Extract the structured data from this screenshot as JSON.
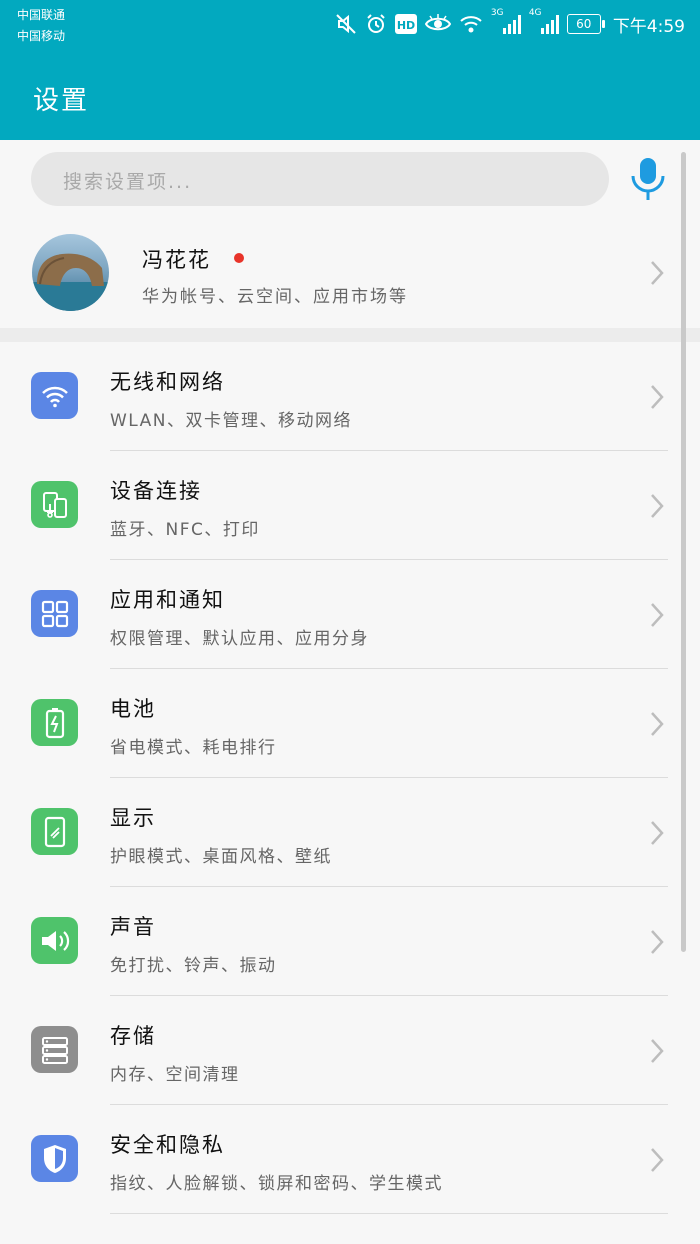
{
  "status_bar": {
    "carrier_1": "中国联通",
    "carrier_2": "中国移动",
    "net_3g": "3G",
    "net_4g": "4G",
    "battery": "60",
    "time": "下午4:59"
  },
  "header": {
    "title": "设置"
  },
  "search": {
    "placeholder": "搜索设置项..."
  },
  "account": {
    "name": "冯花花",
    "subtitle": "华为帐号、云空间、应用市场等"
  },
  "settings": [
    {
      "title": "无线和网络",
      "subtitle": "WLAN、双卡管理、移动网络",
      "icon": "wifi-icon",
      "color": "#5b86e5"
    },
    {
      "title": "设备连接",
      "subtitle": "蓝牙、NFC、打印",
      "icon": "device-connection-icon",
      "color": "#4fc36b"
    },
    {
      "title": "应用和通知",
      "subtitle": "权限管理、默认应用、应用分身",
      "icon": "apps-grid-icon",
      "color": "#5b86e5"
    },
    {
      "title": "电池",
      "subtitle": "省电模式、耗电排行",
      "icon": "battery-icon",
      "color": "#4fc36b"
    },
    {
      "title": "显示",
      "subtitle": "护眼模式、桌面风格、壁纸",
      "icon": "display-icon",
      "color": "#4fc36b"
    },
    {
      "title": "声音",
      "subtitle": "免打扰、铃声、振动",
      "icon": "speaker-icon",
      "color": "#4fc36b"
    },
    {
      "title": "存储",
      "subtitle": "内存、空间清理",
      "icon": "storage-icon",
      "color": "#8e8e8e"
    },
    {
      "title": "安全和隐私",
      "subtitle": "指纹、人脸解锁、锁屏和密码、学生模式",
      "icon": "shield-icon",
      "color": "#5b86e5"
    }
  ]
}
